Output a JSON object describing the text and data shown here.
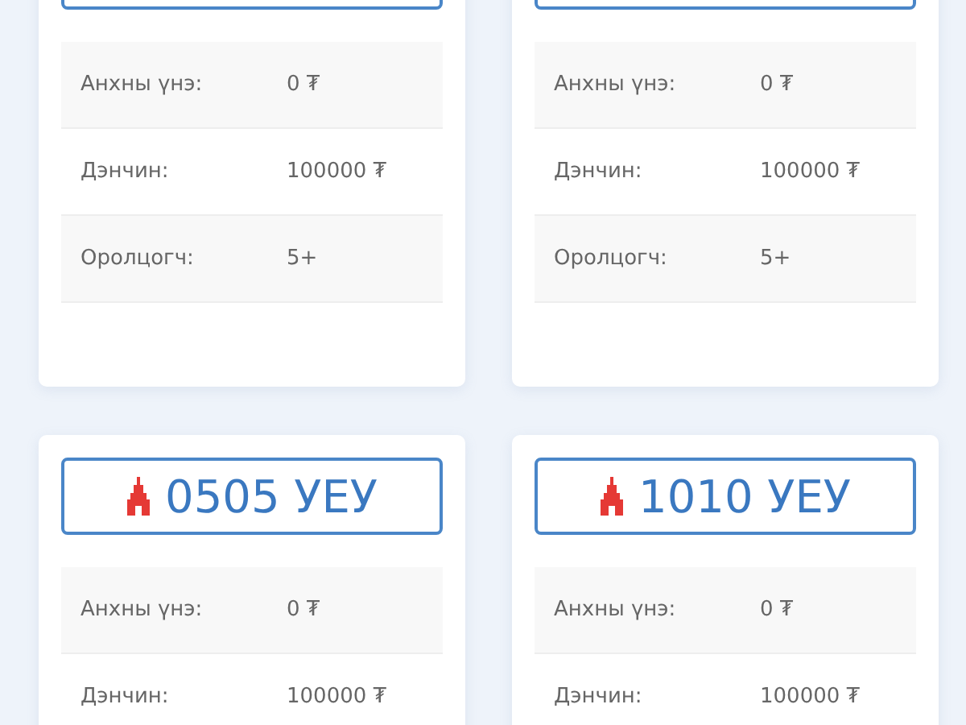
{
  "cards": [
    {
      "rows": [
        {
          "label": "Анхны үнэ:",
          "value": "0 ₮"
        },
        {
          "label": "Дэнчин:",
          "value": "100000 ₮"
        },
        {
          "label": "Оролцогч:",
          "value": "5+"
        }
      ]
    },
    {
      "rows": [
        {
          "label": "Анхны үнэ:",
          "value": "0 ₮"
        },
        {
          "label": "Дэнчин:",
          "value": "100000 ₮"
        },
        {
          "label": "Оролцогч:",
          "value": "5+"
        }
      ]
    },
    {
      "plate": "0505 УЕУ",
      "rows": [
        {
          "label": "Анхны үнэ:",
          "value": "0 ₮"
        },
        {
          "label": "Дэнчин:",
          "value": "100000 ₮"
        }
      ]
    },
    {
      "plate": "1010 УЕУ",
      "rows": [
        {
          "label": "Анхны үнэ:",
          "value": "0 ₮"
        },
        {
          "label": "Дэнчин:",
          "value": "100000 ₮"
        }
      ]
    }
  ]
}
